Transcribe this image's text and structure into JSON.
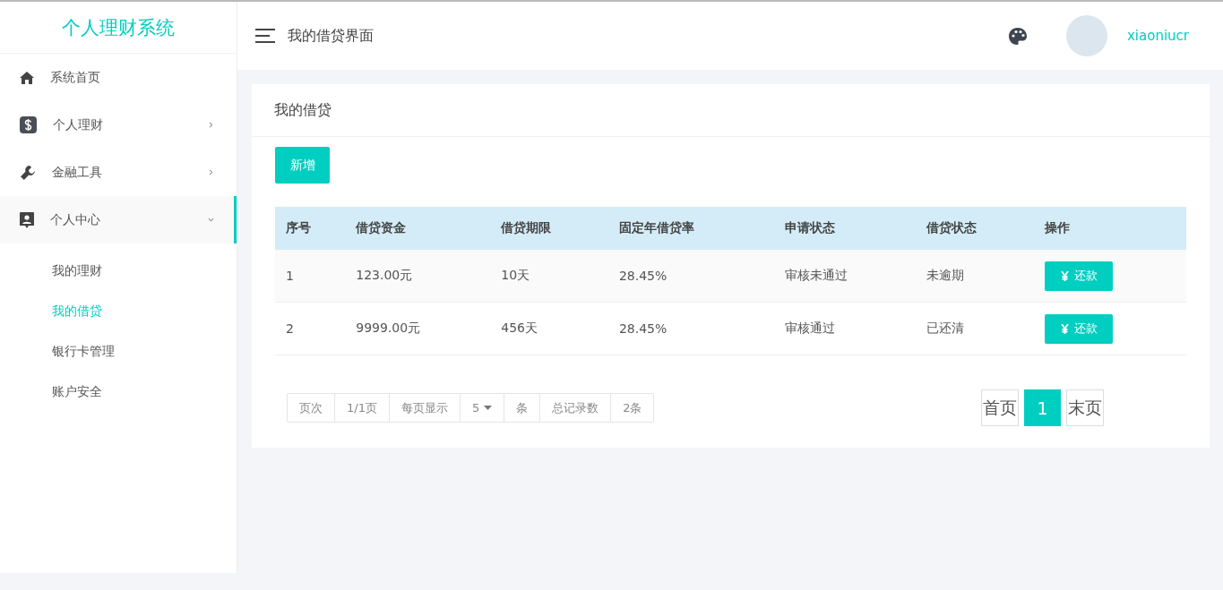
{
  "app_title": "个人理财系统",
  "sidebar": {
    "items": [
      {
        "label": "系统首页",
        "kind": "link",
        "selected": false
      },
      {
        "label": "个人理财",
        "kind": "group",
        "expanded": false,
        "selected": false
      },
      {
        "label": "金融工具",
        "kind": "group",
        "expanded": false,
        "selected": false
      },
      {
        "label": "个人中心",
        "kind": "group",
        "expanded": true,
        "selected": true,
        "children": [
          {
            "label": "我的理财",
            "selected": false
          },
          {
            "label": "我的借贷",
            "selected": true
          },
          {
            "label": "银行卡管理",
            "selected": false
          },
          {
            "label": "账户安全",
            "selected": false
          }
        ]
      }
    ]
  },
  "header": {
    "title": "我的借贷界面",
    "username": "xiaoniucr"
  },
  "panel": {
    "title": "我的借贷",
    "add_button": "新增",
    "table": {
      "columns": [
        "序号",
        "借贷资金",
        "借贷期限",
        "固定年借贷率",
        "申请状态",
        "借贷状态",
        "操作"
      ],
      "rows": [
        {
          "cells": [
            "1",
            "123.00元",
            "10天",
            "28.45%",
            "审核未通过",
            "未逾期"
          ],
          "action": "还款"
        },
        {
          "cells": [
            "2",
            "9999.00元",
            "456天",
            "28.45%",
            "审核通过",
            "已还清"
          ],
          "action": "还款"
        }
      ]
    },
    "page_info": [
      {
        "kind": "text",
        "label": "页次"
      },
      {
        "kind": "text",
        "label": "1/1页"
      },
      {
        "kind": "text",
        "label": "每页显示"
      },
      {
        "kind": "select",
        "label": "5"
      },
      {
        "kind": "text",
        "label": "条"
      },
      {
        "kind": "text",
        "label": "总记录数"
      },
      {
        "kind": "text",
        "label": "2条"
      }
    ],
    "pager": [
      {
        "label": "首页",
        "selected": false
      },
      {
        "label": "1",
        "selected": true
      },
      {
        "label": "末页",
        "selected": false
      }
    ]
  }
}
